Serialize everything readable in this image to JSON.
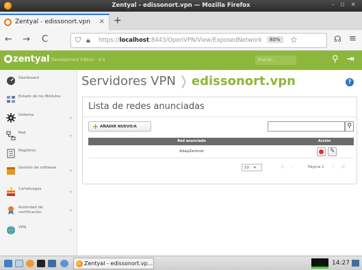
{
  "window": {
    "title": "Zentyal - edissonort.vpn — Mozilla Firefox",
    "controls": "- ▫ ×"
  },
  "browser": {
    "tab_title": "Zentyal - edissonort.vpn",
    "tab_close": "×",
    "new_tab": "+",
    "nav": {
      "back": "←",
      "forward": "→",
      "reload": "C"
    },
    "url_host": "localhost",
    "url_prefix": "https://",
    "url_rest": ":8443/OpenVPN/View/ExposedNetwork",
    "zoom": "80%",
    "star": "☆",
    "pocket": "☊",
    "menu": "≡"
  },
  "app": {
    "logo": "zentyal",
    "edition": "Development Edition",
    "version": "4.0",
    "search_placeholder": "Buscar...",
    "search_icon": "search-icon",
    "logout_icon": "logout-icon"
  },
  "sidebar": {
    "items": [
      {
        "label": "Dashboard",
        "icon": "dashboard-icon",
        "arrow": ""
      },
      {
        "label": "Estado de los Módulos",
        "icon": "modules-status-icon",
        "arrow": ""
      },
      {
        "label": "Sistema",
        "icon": "gear-icon",
        "arrow": "‹"
      },
      {
        "label": "Red",
        "icon": "network-icon",
        "arrow": "‹"
      },
      {
        "label": "Registros",
        "icon": "logs-icon",
        "arrow": ""
      },
      {
        "label": "Gestión de software",
        "icon": "software-icon",
        "arrow": "‹"
      },
      {
        "label": "Cortafuegos",
        "icon": "firewall-icon",
        "arrow": "‹"
      },
      {
        "label": "Autoridad de certificación",
        "icon": "certificate-icon",
        "arrow": "‹"
      },
      {
        "label": "VPN",
        "icon": "vpn-icon",
        "arrow": "‹"
      }
    ]
  },
  "main": {
    "breadcrumb_parent": "Servidores VPN",
    "breadcrumb_sep": "❭",
    "breadcrumb_current": "edissonort.vpn",
    "help": "?",
    "card_title": "Lista de redes anunciadas",
    "add_button": "AÑADIR NUEVO/A",
    "add_icon": "+",
    "filter_value": "",
    "filter_icon": "search-icon",
    "table": {
      "headers": [
        "Red anunciada",
        "Acción"
      ],
      "rows": [
        {
          "network": "AdapZentnet"
        }
      ]
    },
    "pager": {
      "page_size": "10",
      "first": "|‹",
      "prev": "‹",
      "page_label": "Página 1",
      "next": "›",
      "last": "›|"
    }
  },
  "taskbar": {
    "task_label": "Zentyal - edissonort.vp...",
    "clock": "14:27"
  },
  "colors": {
    "zentyal_green": "#8cb63c",
    "delete_red": "#d9352b",
    "help_blue": "#2a77c9"
  }
}
